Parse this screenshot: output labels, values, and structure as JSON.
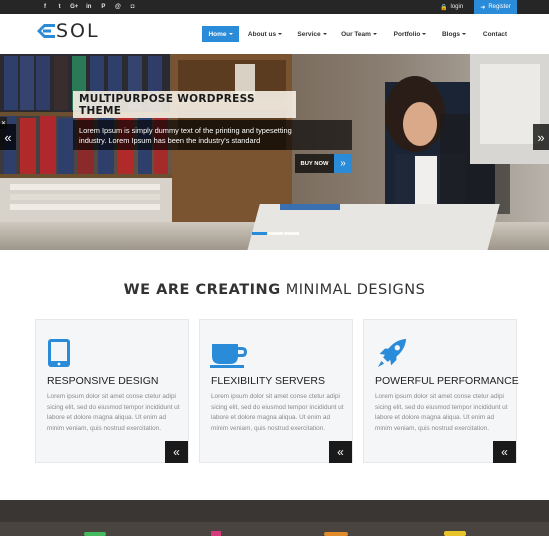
{
  "topbar": {
    "social_icons": [
      {
        "name": "facebook-icon",
        "glyph": "f"
      },
      {
        "name": "twitter-icon",
        "glyph": "t"
      },
      {
        "name": "google-plus-icon",
        "glyph": "G+"
      },
      {
        "name": "linkedin-icon",
        "glyph": "in"
      },
      {
        "name": "pinterest-icon",
        "glyph": "P"
      },
      {
        "name": "dribbble-icon",
        "glyph": "@"
      },
      {
        "name": "instagram-icon",
        "glyph": "◘"
      }
    ],
    "login_label": "login",
    "register_label": "Register"
  },
  "brand": {
    "name": "SOL"
  },
  "nav": {
    "items": [
      {
        "label": "Home",
        "has_caret": true,
        "active": true
      },
      {
        "label": "About us",
        "has_caret": true,
        "active": false
      },
      {
        "label": "Service",
        "has_caret": true,
        "active": false
      },
      {
        "label": "Our Team",
        "has_caret": true,
        "active": false
      },
      {
        "label": "Portfolio",
        "has_caret": true,
        "active": false
      },
      {
        "label": "Blogs",
        "has_caret": true,
        "active": false
      },
      {
        "label": "Contact",
        "has_caret": false,
        "active": false
      }
    ]
  },
  "hero": {
    "title": "MULTIPURPOSE WORDPRESS THEME",
    "subtitle_line1": "Lorem Ipsum is simply dummy text of the printing and typesetting",
    "subtitle_line2": "industry. Lorem Ipsum has been the industry's standard",
    "cta_label": "BUY NOW",
    "slide_count": 3,
    "active_slide": 1
  },
  "section": {
    "title_bold": "WE ARE CREATING",
    "title_light": "MINIMAL DESIGNS"
  },
  "features": [
    {
      "icon": "tablet-icon",
      "title": "RESPONSIVE DESIGN",
      "text": "Lorem ipsum dolor sit amet conse ctetur adipi sicing elit, sed do eiusmod tempor incididunt ut labore et dolore magna aliqua. Ut enim ad minim veniam, quis nostrud exercitation."
    },
    {
      "icon": "coffee-cup-icon",
      "title": "FLEXIBILITY SERVERS",
      "text": "Lorem ipsum dolor sit amet conse ctetur adipi sicing elit, sed do eiusmod tempor incididunt ut labore et dolore magna aliqua. Ut enim ad minim veniam, quis nostrud exercitation."
    },
    {
      "icon": "rocket-icon",
      "title": "POWERFUL PERFORMANCE",
      "text": "Lorem ipsum dolor sit amet conse ctetur adipi sicing elit, sed do eiusmod tempor incididunt ut labore et dolore magna aliqua. Ut enim ad minim veniam, quis nostrud exercitation."
    }
  ],
  "colors": {
    "accent": "#2a8bd8",
    "topbar": "#262626",
    "card_bg": "#f5f6f8",
    "dark_button": "#1a1a1a"
  }
}
